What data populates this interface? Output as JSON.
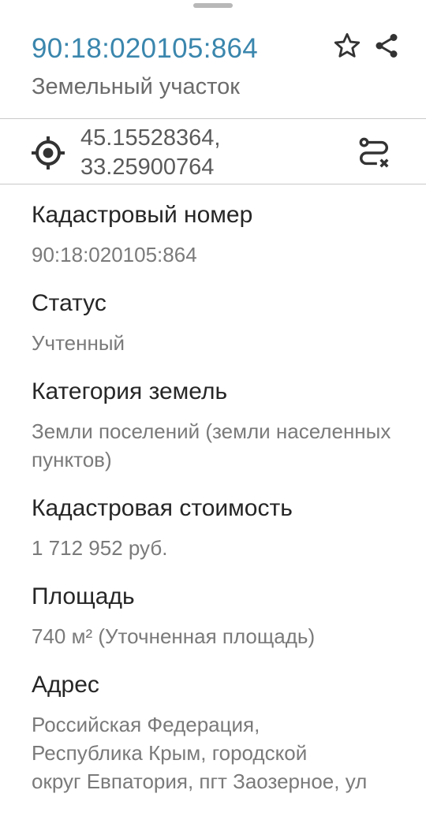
{
  "header": {
    "title": "90:18:020105:864",
    "subtitle": "Земельный участок"
  },
  "icons": {
    "star": "star-outline-icon",
    "share": "share-icon",
    "locate": "gps-locate-icon",
    "route": "route-remove-icon"
  },
  "coordinates": {
    "lat": "45.15528364,",
    "lon": "33.25900764"
  },
  "fields": [
    {
      "label": "Кадастровый номер",
      "value": "90:18:020105:864"
    },
    {
      "label": "Статус",
      "value": "Учтенный"
    },
    {
      "label": "Категория земель",
      "value": "Земли поселений (земли населенных пунктов)"
    },
    {
      "label": "Кадастровая стоимость",
      "value": "1 712 952 руб."
    },
    {
      "label": "Площадь",
      "value": "740 м² (Уточненная площадь)"
    },
    {
      "label": "Адрес",
      "value_lines": [
        "Российская Федерация,",
        "Республика Крым, городской",
        "округ Евпатория, пгт Заозерное, ул"
      ]
    }
  ],
  "colors": {
    "accent": "#3a86ad",
    "label": "#262626",
    "value": "#7a7a7a",
    "divider": "#c9c9c9"
  }
}
